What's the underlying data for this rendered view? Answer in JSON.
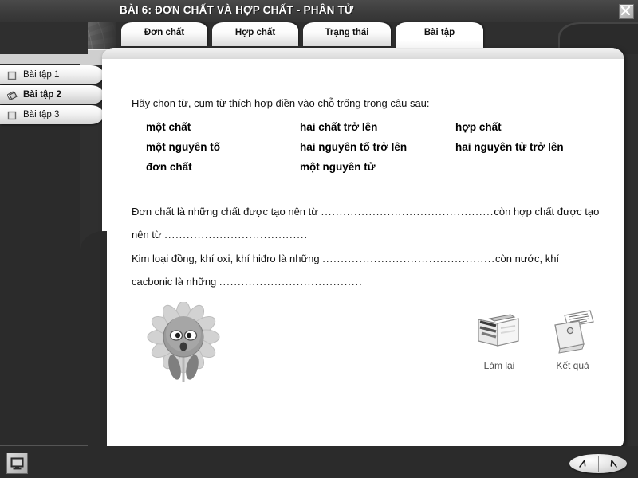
{
  "window": {
    "title": "BÀI 6: ĐƠN CHẤT VÀ HỢP CHẤT - PHÂN TỬ",
    "close_label": "×",
    "close_icon": "close-icon",
    "accent_dark": "#2b2b2b",
    "panel_bg": "#ffffff"
  },
  "tabs": [
    {
      "label": "Đơn chất",
      "active": false
    },
    {
      "label": "Hợp chất",
      "active": false
    },
    {
      "label": "Trạng thái",
      "active": false
    },
    {
      "label": "Bài tập",
      "active": true
    }
  ],
  "sidebar": {
    "items": [
      {
        "label": "Bài tập 1",
        "icon": "square-icon",
        "selected": false
      },
      {
        "label": "Bài tập 2",
        "icon": "diamond-icon",
        "selected": true
      },
      {
        "label": "Bài tập 3",
        "icon": "square-icon",
        "selected": false
      }
    ]
  },
  "exercise": {
    "prompt": "Hãy chọn từ, cụm từ thích hợp điền vào chỗ trống trong câu sau:",
    "word_bank": [
      [
        "một chất",
        "hai chất trở lên",
        "hợp chất"
      ],
      [
        "một nguyên tố",
        "hai nguyên tố trở lên",
        "hai nguyên tử trở lên"
      ],
      [
        "đơn chất",
        "một nguyên tử",
        ""
      ]
    ],
    "paragraph_1": {
      "part_a": "Đơn chất là những chất được tạo nên từ ",
      "blank_a": "...............................................",
      "part_b": "còn hợp chất",
      "part_c": "được tạo nên từ ",
      "blank_b": "......................................."
    },
    "paragraph_2": {
      "part_a": "Kim loại đồng, khí oxi, khí hiđro là những ",
      "blank_a": "...............................................",
      "part_b": "còn nước, khí",
      "part_c": "cacbonic là những ",
      "blank_b": "......................................."
    }
  },
  "mascot": {
    "name": "sunflower-mascot-icon"
  },
  "actions": [
    {
      "label": "Làm lại",
      "icon": "book-redo-icon"
    },
    {
      "label": "Kết quả",
      "icon": "result-printer-icon"
    }
  ],
  "bottom": {
    "monitor_icon": "monitor-icon",
    "prev_icon": "arrow-prev-icon",
    "next_icon": "arrow-next-icon"
  }
}
